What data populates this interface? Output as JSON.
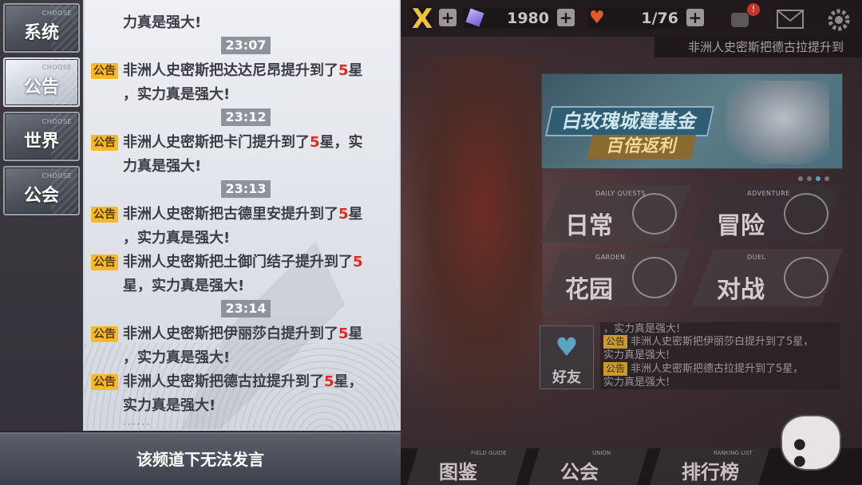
{
  "tabs": [
    {
      "label": "系统",
      "sub": "CHOOSE",
      "active": false
    },
    {
      "label": "公告",
      "sub": "CHOOSE",
      "active": true
    },
    {
      "label": "世界",
      "sub": "CHOOSE",
      "active": false
    },
    {
      "label": "公会",
      "sub": "CHOOSE",
      "active": false
    }
  ],
  "chat": {
    "tag": "公告",
    "entries": [
      {
        "kind": "cont",
        "text": "力真是强大!"
      },
      {
        "kind": "time",
        "text": "23:07"
      },
      {
        "kind": "msg",
        "pre": "非洲人史密斯把达达尼昂提升到了",
        "star": "5",
        "post": "星",
        "line2": "，实力真是强大!"
      },
      {
        "kind": "time",
        "text": "23:12"
      },
      {
        "kind": "msg",
        "pre": "非洲人史密斯把卡门提升到了",
        "star": "5",
        "post": "星，实",
        "line2": "力真是强大!"
      },
      {
        "kind": "time",
        "text": "23:13"
      },
      {
        "kind": "msg",
        "pre": "非洲人史密斯把古德里安提升到了",
        "star": "5",
        "post": "星",
        "line2": "，实力真是强大!"
      },
      {
        "kind": "msg",
        "pre": "非洲人史密斯把土御门结子提升到了",
        "star": "5",
        "post": "",
        "line2": "星，实力真是强大!"
      },
      {
        "kind": "time",
        "text": "23:14"
      },
      {
        "kind": "msg",
        "pre": "非洲人史密斯把伊丽莎白提升到了",
        "star": "5",
        "post": "星",
        "line2": "，实力真是强大!"
      },
      {
        "kind": "msg",
        "pre": "非洲人史密斯把德古拉提升到了",
        "star": "5",
        "post": "星，",
        "line2": "实力真是强大!"
      }
    ],
    "more": "······"
  },
  "speak_bar": {
    "text": "该频道下无法发言"
  },
  "topbar": {
    "close": "X",
    "gems": "1980",
    "stamina": "1/76",
    "plus": "+",
    "notif_count": "!",
    "ticker": "非洲人史密斯把德古拉提升到"
  },
  "banner": {
    "line1": "白玫瑰城建基金",
    "line2": "百倍返利"
  },
  "menu": [
    {
      "en": "DAILY QUESTS",
      "cn": "日常"
    },
    {
      "en": "ADVENTURE",
      "cn": "冒险"
    },
    {
      "en": "GARDEN",
      "cn": "花园"
    },
    {
      "en": "DUEL",
      "cn": "对战"
    }
  ],
  "friend": {
    "label": "好友",
    "icon": "heart-handshake-icon"
  },
  "mini_chat": [
    {
      "text": "，实力真是强大!"
    },
    {
      "tag": "公告",
      "text": "非洲人史密斯把伊丽莎白提升到了5星，"
    },
    {
      "text": "实力真是强大!"
    },
    {
      "tag": "公告",
      "text": "非洲人史密斯把德古拉提升到了5星，"
    },
    {
      "text": "实力真是强大!"
    }
  ],
  "bottom_nav": [
    {
      "cn": "图鉴",
      "en": "FIELD GUIDE"
    },
    {
      "cn": "公会",
      "en": "UNION"
    },
    {
      "cn": "排行榜",
      "en": "RANKING LIST"
    }
  ],
  "colors": {
    "highlight": "#e02a22",
    "tag_bg": "#f5b92a",
    "time_chip": "#8e929d",
    "accent_gold": "#f0c23a"
  }
}
